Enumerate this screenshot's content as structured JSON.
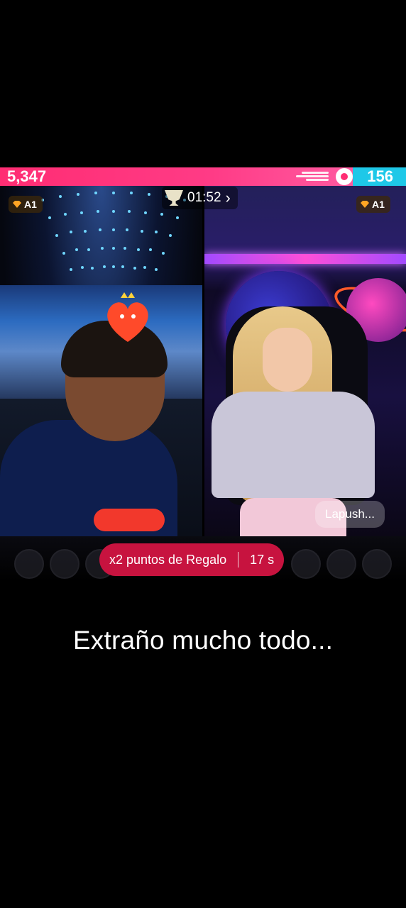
{
  "battle": {
    "score_left": "5,347",
    "score_right": "156",
    "timer": "01:52",
    "timer_chevron": "›",
    "left_level": "A1",
    "right_level": "A1",
    "right_name": "Lapush...",
    "gift_bonus_label": "x2 puntos de Regalo",
    "gift_bonus_time": "17 s",
    "colors": {
      "left_team": "#ff2d73",
      "right_team": "#1ec8e8",
      "gift_pill": "#c7133f"
    }
  },
  "caption": "Extraño mucho todo..."
}
